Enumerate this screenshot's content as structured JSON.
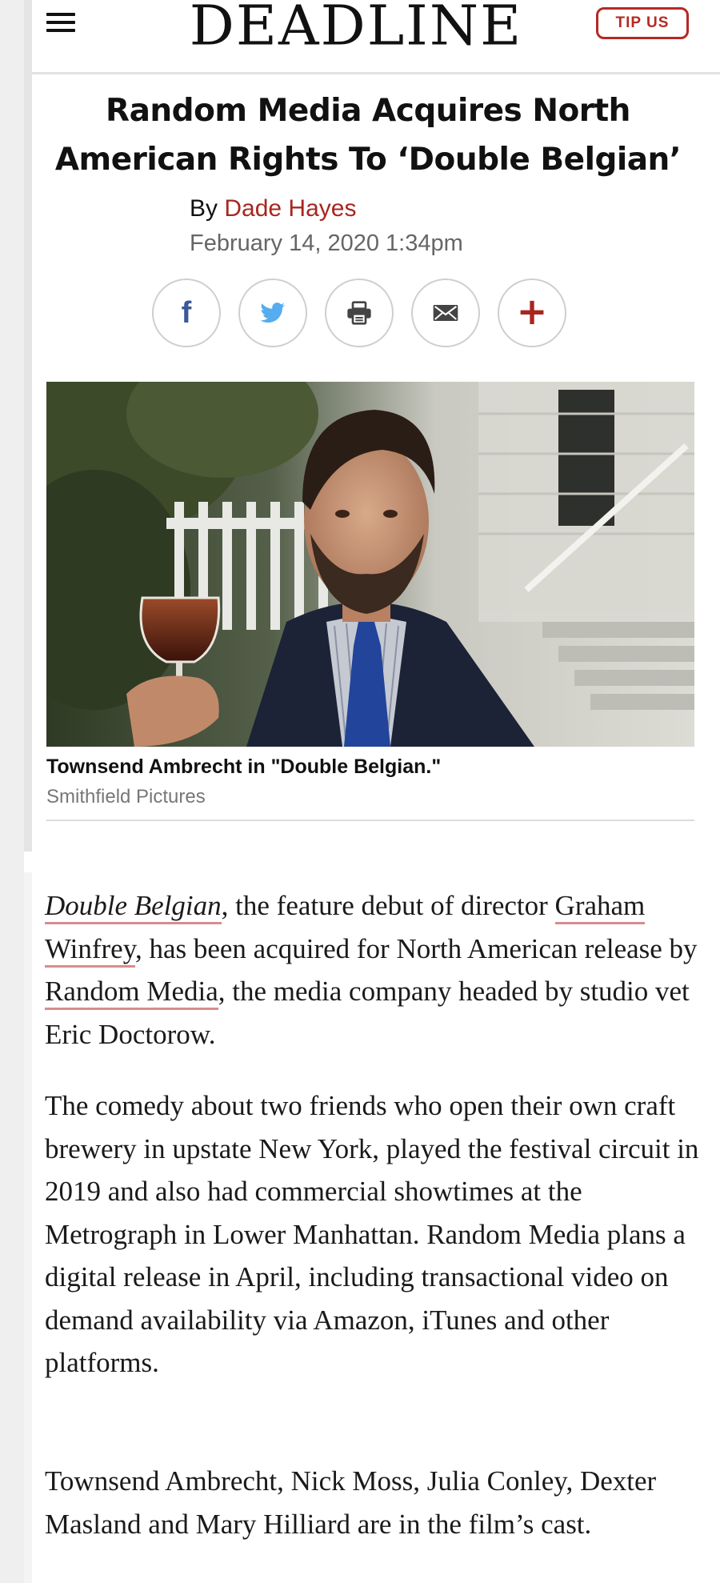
{
  "header": {
    "logo": "DEADLINE",
    "tip_button": "TIP US",
    "menu_icon": "hamburger-menu-icon"
  },
  "article": {
    "headline": "Random Media Acquires North American Rights To ‘Double Belgian’",
    "byline_prefix": "By",
    "author": "Dade Hayes",
    "date": "February 14, 2020 1:34pm"
  },
  "share": {
    "icons": [
      "facebook-icon",
      "twitter-icon",
      "print-icon",
      "email-icon",
      "plus-icon"
    ],
    "facebook_glyph": "f",
    "plus_glyph": "+",
    "colors": {
      "facebook": "#3b5998",
      "twitter": "#55acee",
      "plus": "#a8261f"
    }
  },
  "image": {
    "caption": "Townsend Ambrecht in \"Double Belgian.\"",
    "credit": "Smithfield Pictures"
  },
  "body": {
    "p1": {
      "link1": "Double Belgian",
      "text1": ", the feature debut of director ",
      "link2": "Graham Winfrey",
      "text2": ", has been acquired for North American release by ",
      "link3": "Random Media",
      "text3": ", the media company headed by studio vet Eric Doctorow."
    },
    "p2": "The comedy about two friends who open their own craft brewery in upstate New York, played the festival circuit in 2019 and also had commercial showtimes at the Metrograph in Lower Manhattan. Random Media plans a digital release in April, including transactional video on demand availability via Amazon, iTunes and other platforms.",
    "p3": "Townsend Ambrecht, Nick Moss, Julia Conley, Dexter Masland and Mary Hilliard are in the film’s cast."
  },
  "colors": {
    "accent": "#a8261f",
    "link_underline": "#d88c8c"
  }
}
